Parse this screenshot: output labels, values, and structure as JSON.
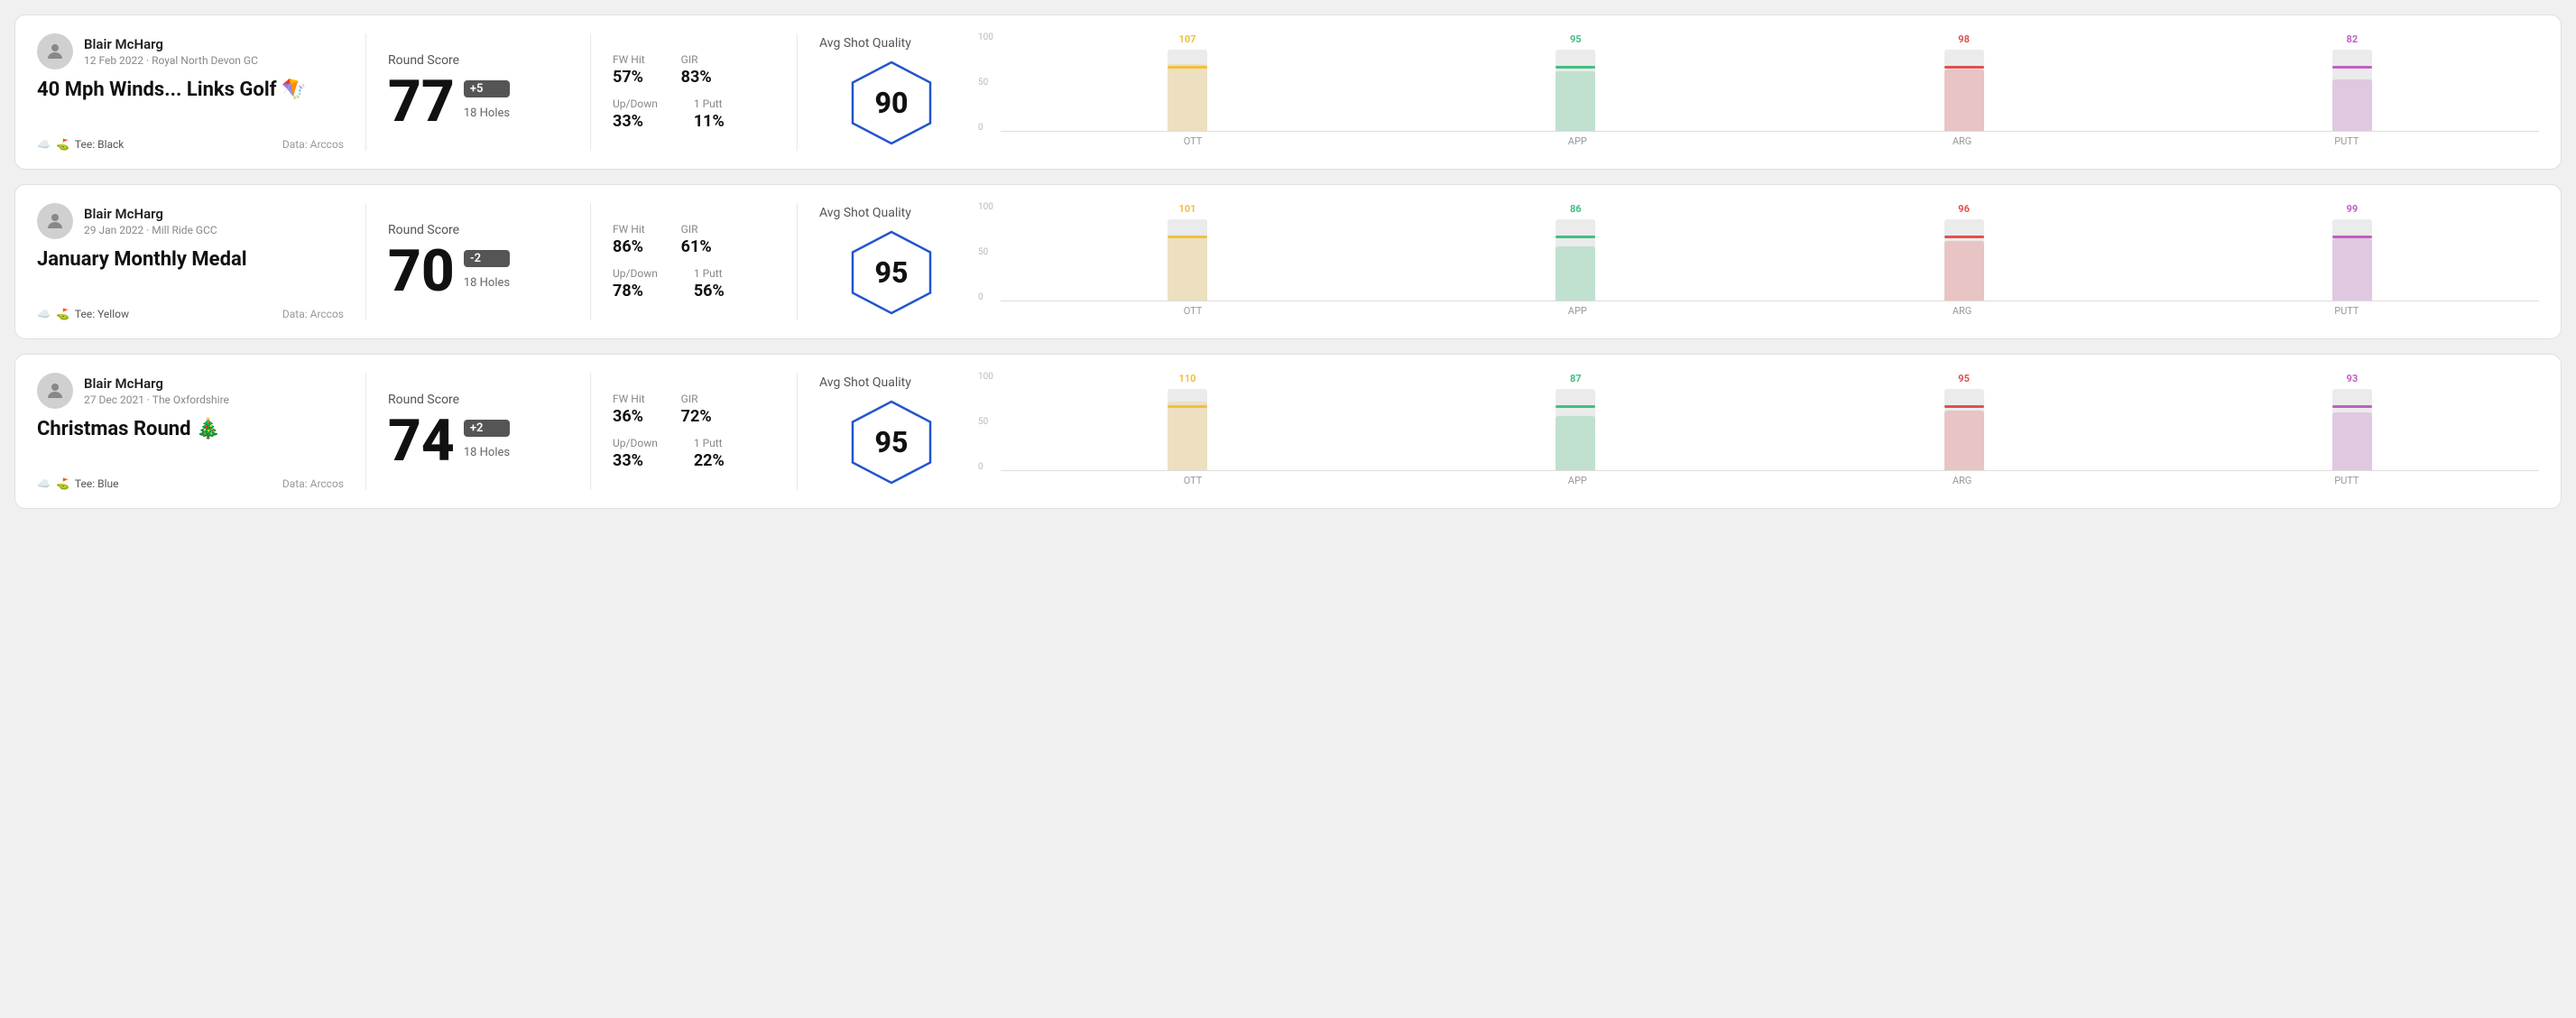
{
  "cards": [
    {
      "id": "card1",
      "user": {
        "name": "Blair McHarg",
        "date": "12 Feb 2022 · Royal North Devon GC"
      },
      "title": "40 Mph Winds... Links Golf",
      "titleEmoji": "🪁",
      "tee": "Black",
      "dataSource": "Data: Arccos",
      "score": {
        "label": "Round Score",
        "number": "77",
        "badge": "+5",
        "holes": "18 Holes"
      },
      "stats": {
        "fwHit": "57%",
        "gir": "83%",
        "upDown": "33%",
        "onePutt": "11%"
      },
      "quality": {
        "label": "Avg Shot Quality",
        "score": "90"
      },
      "chart": {
        "bars": [
          {
            "label": "OTT",
            "value": 107,
            "color": "#f0c040",
            "maxH": 100
          },
          {
            "label": "APP",
            "value": 95,
            "color": "#40c080",
            "maxH": 100
          },
          {
            "label": "ARG",
            "value": 98,
            "color": "#e05050",
            "maxH": 100
          },
          {
            "label": "PUTT",
            "value": 82,
            "color": "#c060c0",
            "maxH": 100
          }
        ]
      }
    },
    {
      "id": "card2",
      "user": {
        "name": "Blair McHarg",
        "date": "29 Jan 2022 · Mill Ride GCC"
      },
      "title": "January Monthly Medal",
      "titleEmoji": "",
      "tee": "Yellow",
      "dataSource": "Data: Arccos",
      "score": {
        "label": "Round Score",
        "number": "70",
        "badge": "-2",
        "holes": "18 Holes"
      },
      "stats": {
        "fwHit": "86%",
        "gir": "61%",
        "upDown": "78%",
        "onePutt": "56%"
      },
      "quality": {
        "label": "Avg Shot Quality",
        "score": "95"
      },
      "chart": {
        "bars": [
          {
            "label": "OTT",
            "value": 101,
            "color": "#f0c040",
            "maxH": 100
          },
          {
            "label": "APP",
            "value": 86,
            "color": "#40c080",
            "maxH": 100
          },
          {
            "label": "ARG",
            "value": 96,
            "color": "#e05050",
            "maxH": 100
          },
          {
            "label": "PUTT",
            "value": 99,
            "color": "#c060c0",
            "maxH": 100
          }
        ]
      }
    },
    {
      "id": "card3",
      "user": {
        "name": "Blair McHarg",
        "date": "27 Dec 2021 · The Oxfordshire"
      },
      "title": "Christmas Round",
      "titleEmoji": "🎄",
      "tee": "Blue",
      "dataSource": "Data: Arccos",
      "score": {
        "label": "Round Score",
        "number": "74",
        "badge": "+2",
        "holes": "18 Holes"
      },
      "stats": {
        "fwHit": "36%",
        "gir": "72%",
        "upDown": "33%",
        "onePutt": "22%"
      },
      "quality": {
        "label": "Avg Shot Quality",
        "score": "95"
      },
      "chart": {
        "bars": [
          {
            "label": "OTT",
            "value": 110,
            "color": "#f0c040",
            "maxH": 100
          },
          {
            "label": "APP",
            "value": 87,
            "color": "#40c080",
            "maxH": 100
          },
          {
            "label": "ARG",
            "value": 95,
            "color": "#e05050",
            "maxH": 100
          },
          {
            "label": "PUTT",
            "value": 93,
            "color": "#c060c0",
            "maxH": 100
          }
        ]
      }
    }
  ],
  "labels": {
    "fwHit": "FW Hit",
    "gir": "GIR",
    "upDown": "Up/Down",
    "onePutt": "1 Putt",
    "dataArccos": "Data: Arccos",
    "teeLabel": "Tee:",
    "yAxis": [
      "100",
      "50",
      "0"
    ]
  }
}
